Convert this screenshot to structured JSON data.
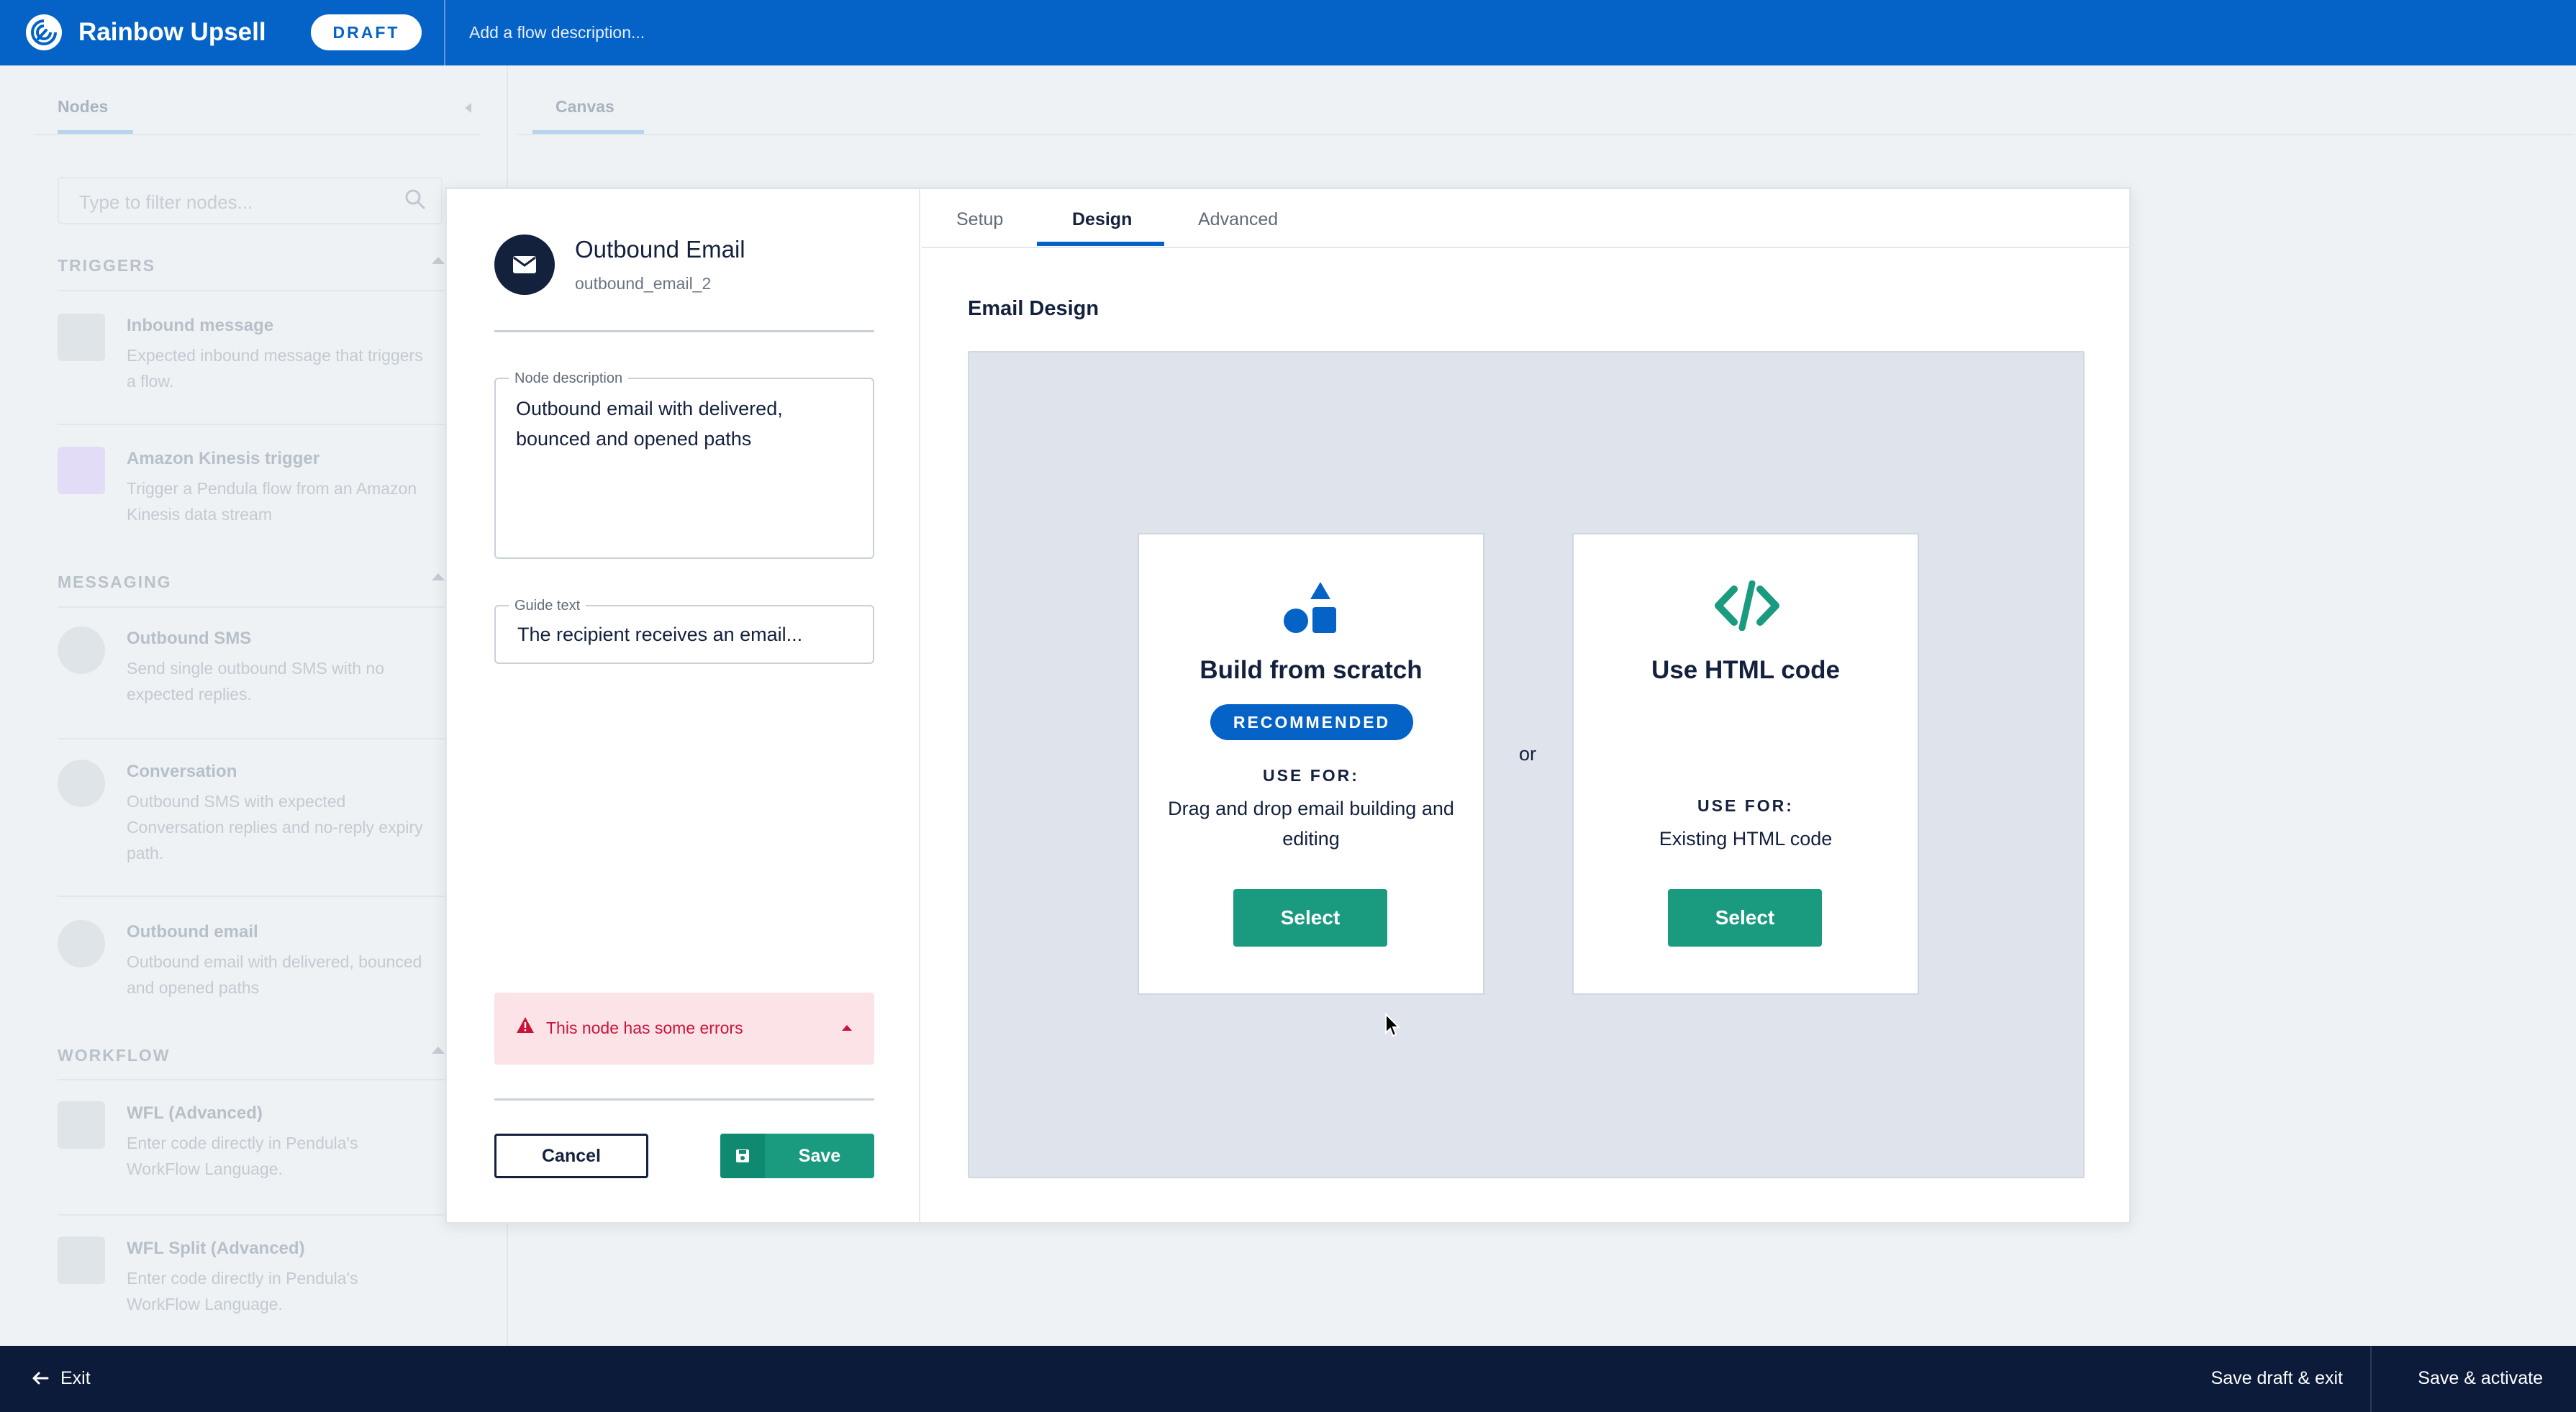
{
  "header": {
    "app_title": "Rainbow Upsell",
    "status_badge": "DRAFT",
    "flow_description_placeholder": "Add a flow description..."
  },
  "left_panel": {
    "tab_nodes": "Nodes",
    "filter_placeholder": "Type to filter nodes...",
    "sections": {
      "triggers": "TRIGGERS",
      "messaging": "MESSAGING",
      "workflow": "WORKFLOW"
    },
    "nodes": [
      {
        "name": "Inbound message",
        "desc": "Expected inbound message that triggers a flow.",
        "icon": "chat-icon"
      },
      {
        "name": "Amazon Kinesis trigger",
        "desc": "Trigger a Pendula flow from an Amazon Kinesis data stream",
        "icon": "kinesis-icon"
      },
      {
        "name": "Outbound SMS",
        "desc": "Send single outbound SMS with no expected replies.",
        "icon": "phone-icon"
      },
      {
        "name": "Conversation",
        "desc": "Outbound SMS with expected Conversation replies and no-reply expiry path.",
        "icon": "conversation-icon"
      },
      {
        "name": "Outbound email",
        "desc": "Outbound email with delivered, bounced and opened paths",
        "icon": "email-icon"
      },
      {
        "name": "WFL (Advanced)",
        "desc": "Enter code directly in Pendula's WorkFlow Language.",
        "icon": "grid-icon"
      },
      {
        "name": "WFL Split (Advanced)",
        "desc": "Enter code directly in Pendula's WorkFlow Language.",
        "icon": "grid-icon"
      }
    ]
  },
  "canvas": {
    "tab_canvas": "Canvas"
  },
  "modal": {
    "node_title": "Outbound Email",
    "node_id": "outbound_email_2",
    "description_label": "Node description",
    "description_value": "Outbound email with delivered, bounced and opened paths",
    "guide_label": "Guide text",
    "guide_value": "The recipient receives an email...",
    "error_text": "This node has some errors",
    "cancel_label": "Cancel",
    "save_label": "Save",
    "tabs": [
      "Setup",
      "Design",
      "Advanced"
    ],
    "active_tab": "Design",
    "section_title": "Email Design",
    "option_build": {
      "title": "Build from scratch",
      "badge": "RECOMMENDED",
      "use_for_label": "USE FOR:",
      "use_for_desc": "Drag and drop email building and editing",
      "select_label": "Select"
    },
    "or_text": "or",
    "option_html": {
      "title": "Use HTML code",
      "use_for_label": "USE FOR:",
      "use_for_desc": "Existing HTML code",
      "select_label": "Select"
    }
  },
  "footer": {
    "exit_label": "Exit",
    "save_draft_label": "Save draft & exit",
    "save_activate_label": "Save & activate"
  },
  "colors": {
    "brand_blue": "#0563c7",
    "navy": "#14213d",
    "teal": "#1a9a7f",
    "error_red": "#c9143a",
    "error_bg": "#fbe3e7"
  }
}
